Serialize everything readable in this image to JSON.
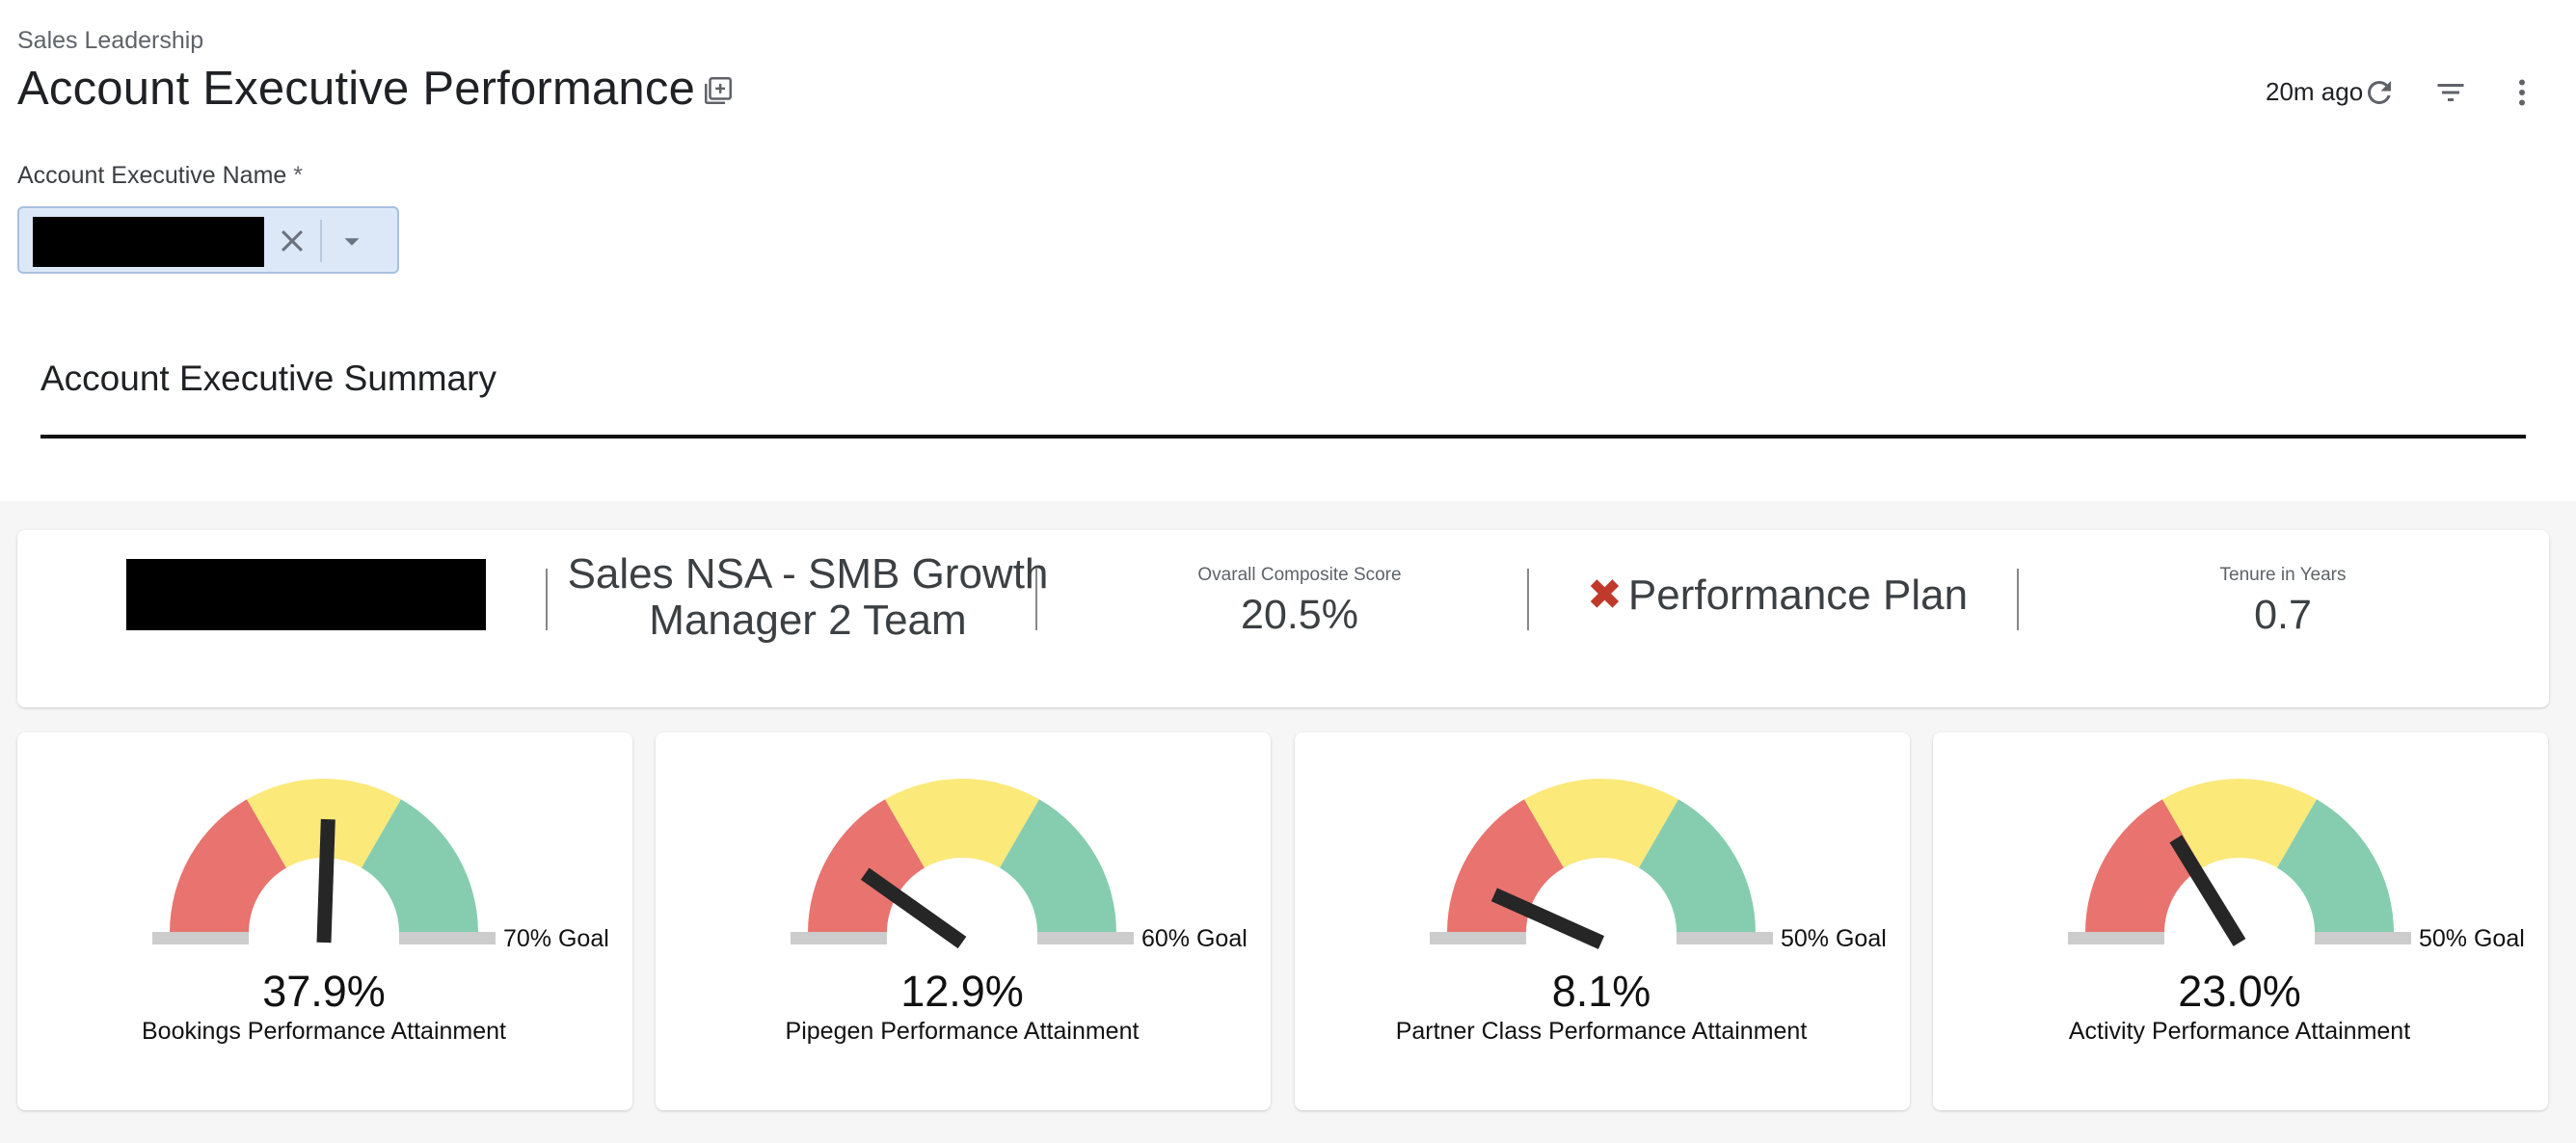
{
  "header": {
    "breadcrumb": "Sales Leadership",
    "title": "Account Executive Performance",
    "updated": "20m ago",
    "icons": [
      "add-to-board-icon",
      "refresh-icon",
      "filter-icon",
      "more-vert-icon"
    ]
  },
  "filter": {
    "label": "Account Executive Name",
    "required_mark": "*",
    "value_redacted": true
  },
  "section": {
    "title": "Account Executive Summary"
  },
  "summary": {
    "name_redacted": true,
    "team": "Sales NSA - SMB Growth Manager 2 Team",
    "composite_label": "Ovarall Composite Score",
    "composite_value": "20.5%",
    "status": "Performance Plan",
    "status_color": "#c0392b",
    "tenure_label": "Tenure in Years",
    "tenure_value": "0.7"
  },
  "gauges": [
    {
      "label": "Bookings Performance Attainment",
      "value_text": "37.9%",
      "value": 37.9,
      "goal_text": "70% Goal",
      "goal": 70
    },
    {
      "label": "Pipegen Performance Attainment",
      "value_text": "12.9%",
      "value": 12.9,
      "goal_text": "60% Goal",
      "goal": 60
    },
    {
      "label": "Partner Class Performance Attainment",
      "value_text": "8.1%",
      "value": 8.1,
      "goal_text": "50% Goal",
      "goal": 50
    },
    {
      "label": "Activity Performance Attainment",
      "value_text": "23.0%",
      "value": 23.0,
      "goal_text": "50% Goal",
      "goal": 50
    }
  ],
  "colors": {
    "gauge_red": "#e8736f",
    "gauge_yellow": "#fbe97a",
    "gauge_green": "#86cdb0",
    "gauge_needle": "#262626",
    "gauge_base": "#cccccc",
    "select_bg": "#dce8f8"
  }
}
